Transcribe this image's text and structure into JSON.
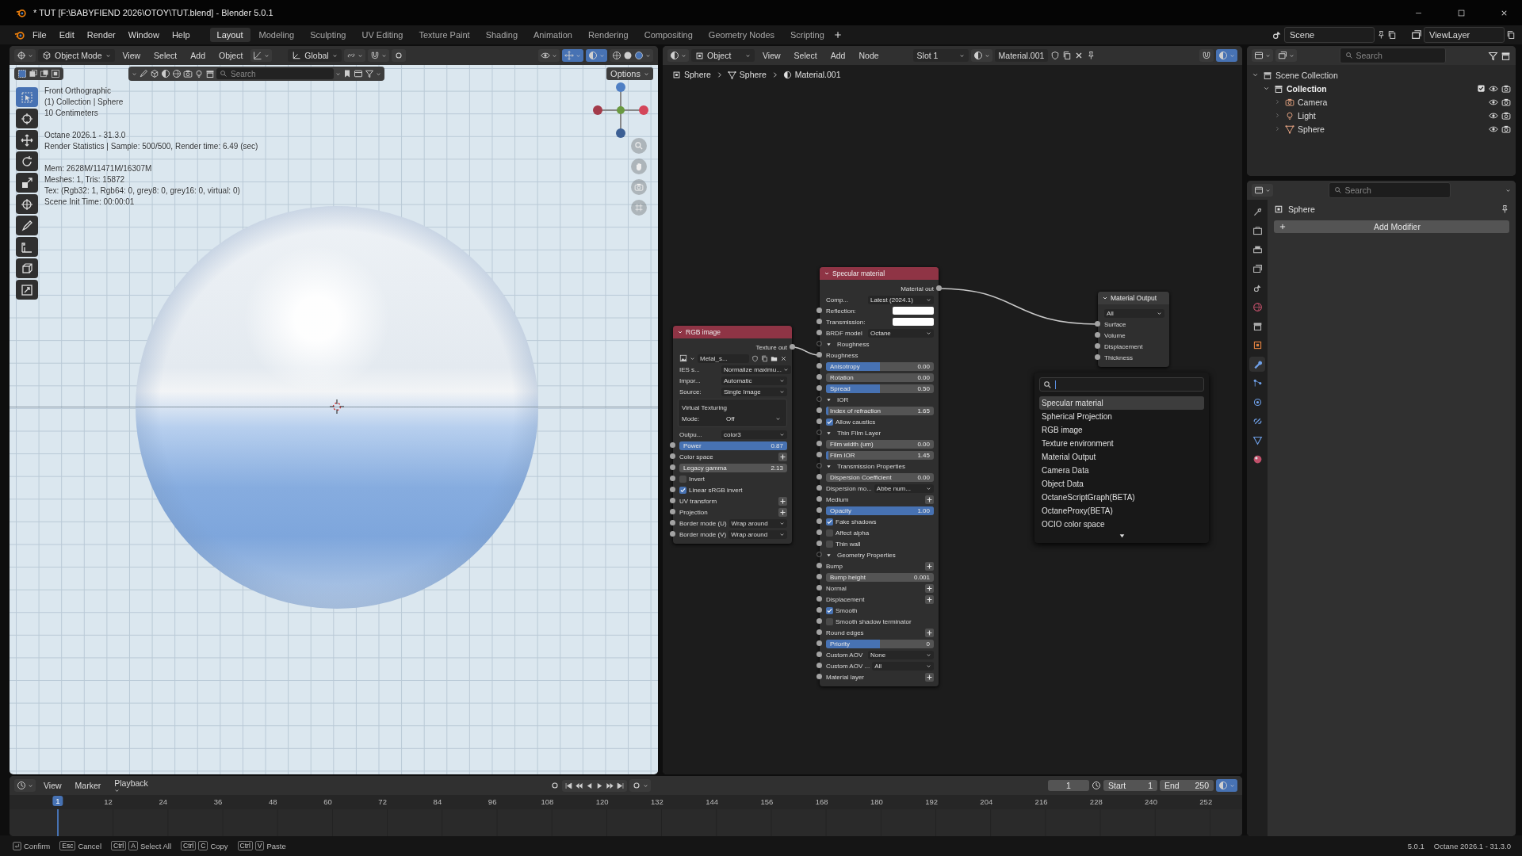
{
  "window": {
    "title": "* TUT [F:\\BABYFIEND 2026\\OTOY\\TUT.blend] - Blender 5.0.1"
  },
  "menu": [
    "File",
    "Edit",
    "Render",
    "Window",
    "Help"
  ],
  "workspaces": [
    {
      "label": "Layout",
      "selected": true
    },
    {
      "label": "Modeling",
      "selected": false
    },
    {
      "label": "Sculpting",
      "selected": false
    },
    {
      "label": "UV Editing",
      "selected": false
    },
    {
      "label": "Texture Paint",
      "selected": false
    },
    {
      "label": "Shading",
      "selected": false
    },
    {
      "label": "Animation",
      "selected": false
    },
    {
      "label": "Rendering",
      "selected": false
    },
    {
      "label": "Compositing",
      "selected": false
    },
    {
      "label": "Geometry Nodes",
      "selected": false
    },
    {
      "label": "Scripting",
      "selected": false
    }
  ],
  "scene": "Scene",
  "view_layer": "ViewLayer",
  "viewport": {
    "mode": "Object Mode",
    "menus": [
      "View",
      "Select",
      "Add",
      "Object"
    ],
    "orientation": "Global",
    "search": {
      "placeholder": "Search"
    },
    "options": "Options",
    "tools": [
      {
        "kind": "select",
        "selected": true
      },
      {
        "kind": "cursor",
        "selected": false
      },
      {
        "kind": "move",
        "selected": false
      },
      {
        "kind": "rotate",
        "selected": false
      },
      {
        "kind": "scale",
        "selected": false
      },
      {
        "kind": "transform",
        "selected": false
      },
      {
        "kind": "annotate",
        "selected": false
      },
      {
        "kind": "measure",
        "selected": false
      },
      {
        "kind": "add_cube",
        "selected": false
      },
      {
        "kind": "crop",
        "selected": false
      }
    ],
    "overlay": [
      [
        "Front Orthographic",
        "(1) Collection | Sphere",
        "10 Centimeters"
      ],
      [
        "Octane 2026.1 - 31.3.0",
        "Render Statistics | Sample: 500/500, Render time: 6.49 (sec)"
      ],
      [
        "Mem: 2628M/11471M/16307M",
        "Meshes: 1, Tris: 15872",
        "Tex: (Rgb32: 1, Rgb64: 0, grey8: 0, grey16: 0, virtual: 0)",
        "Scene Init Time: 00:00:01"
      ]
    ]
  },
  "node_editor": {
    "type": "Object",
    "menus": [
      "View",
      "Select",
      "Add",
      "Node"
    ],
    "slot": "Slot 1",
    "material": "Material.001",
    "breadcrumbs": [
      "Sphere",
      "Sphere",
      "Material.001"
    ],
    "nodes": [
      {
        "title": "RGB image",
        "kind": "texture",
        "rows": [
          {
            "kind": "output",
            "label": "Texture out",
            "socket": true
          },
          {
            "kind": "image",
            "value": "Metal_s...",
            "socket": false
          },
          {
            "kind": "dropdown",
            "label": "IES s...",
            "value": "Normalize maximu...",
            "socket": false
          },
          {
            "kind": "dropdown",
            "label": "Impor...",
            "value": "Automatic",
            "socket": false
          },
          {
            "kind": "dropdown",
            "label": "Source:",
            "value": "Single Image",
            "socket": false
          },
          {
            "kind": "group",
            "label": "Virtual Texturing",
            "socket": false,
            "rows": [
              {
                "kind": "dropdown",
                "label": "Mode:",
                "value": "Off",
                "socket": false
              }
            ]
          },
          {
            "kind": "dropdown",
            "label": "Outpu...",
            "value": "color3",
            "socket": false
          },
          {
            "kind": "slider",
            "label": "Power",
            "value": "0.87",
            "level": 1,
            "socket": true
          },
          {
            "kind": "add",
            "label": "Color space",
            "socket": true
          },
          {
            "kind": "slider",
            "label": "Legacy gamma",
            "value": "2.13",
            "level": 0,
            "socket": true
          },
          {
            "kind": "checkbox",
            "label": "Invert",
            "checked": false,
            "socket": true
          },
          {
            "kind": "checkbox",
            "label": "Linear sRGB invert",
            "checked": true,
            "socket": true
          },
          {
            "kind": "add",
            "label": "UV transform",
            "socket": true
          },
          {
            "kind": "add",
            "label": "Projection",
            "socket": true
          },
          {
            "kind": "dropdown",
            "label": "Border mode (U)",
            "value": "Wrap around",
            "socket": true
          },
          {
            "kind": "dropdown",
            "label": "Border mode (V)",
            "value": "Wrap around",
            "socket": true
          }
        ]
      },
      {
        "title": "Specular material",
        "kind": "material",
        "rows": [
          {
            "kind": "output",
            "label": "Material out",
            "socket": true
          },
          {
            "kind": "dropdown",
            "label": "Comp...",
            "value": "Latest (2024.1)",
            "socket": false
          },
          {
            "kind": "color",
            "label": "Reflection:",
            "color": "#ffffff",
            "socket": true
          },
          {
            "kind": "color",
            "label": "Transmission:",
            "color": "#ffffff",
            "socket": true
          },
          {
            "kind": "dropdown",
            "label": "BRDF model",
            "value": "Octane",
            "socket": true
          },
          {
            "kind": "section",
            "label": "Roughness",
            "expanded": true,
            "socket": true
          },
          {
            "kind": "input",
            "label": "Roughness",
            "socket": true
          },
          {
            "kind": "slider",
            "label": "Anisotropy",
            "value": "0.00",
            "level": 0.5,
            "socket": true
          },
          {
            "kind": "slider",
            "label": "Rotation",
            "value": "0.00",
            "level": 0,
            "socket": true
          },
          {
            "kind": "slider",
            "label": "Spread",
            "value": "0.50",
            "level": 0.5,
            "socket": true
          },
          {
            "kind": "section",
            "label": "IOR",
            "expanded": true,
            "socket": true
          },
          {
            "kind": "slider",
            "label": "Index of refraction",
            "value": "1.65",
            "level": 0.02,
            "socket": true
          },
          {
            "kind": "checkbox",
            "label": "Allow caustics",
            "checked": true,
            "socket": true
          },
          {
            "kind": "section",
            "label": "Thin Film Layer",
            "expanded": true,
            "socket": true
          },
          {
            "kind": "slider",
            "label": "Film width (um)",
            "value": "0.00",
            "level": 0,
            "socket": true
          },
          {
            "kind": "slider",
            "label": "Film IOR",
            "value": "1.45",
            "level": 0.02,
            "socket": true
          },
          {
            "kind": "section",
            "label": "Transmission Properties",
            "expanded": true,
            "socket": true
          },
          {
            "kind": "slider",
            "label": "Dispersion Coefficient",
            "value": "0.00",
            "level": 0,
            "socket": true
          },
          {
            "kind": "dropdown",
            "label": "Dispersion mo...",
            "value": "Abbe num...",
            "socket": true
          },
          {
            "kind": "add",
            "label": "Medium",
            "socket": true
          },
          {
            "kind": "slider",
            "label": "Opacity",
            "value": "1.00",
            "level": 1,
            "socket": true
          },
          {
            "kind": "checkbox",
            "label": "Fake shadows",
            "checked": true,
            "socket": true
          },
          {
            "kind": "checkbox",
            "label": "Affect alpha",
            "checked": false,
            "socket": true
          },
          {
            "kind": "checkbox",
            "label": "Thin wall",
            "checked": false,
            "socket": true
          },
          {
            "kind": "section",
            "label": "Geometry Properties",
            "expanded": true,
            "socket": true
          },
          {
            "kind": "add",
            "label": "Bump",
            "socket": true
          },
          {
            "kind": "slider",
            "label": "Bump height",
            "value": "0.001",
            "level": 0,
            "socket": true
          },
          {
            "kind": "add",
            "label": "Normal",
            "socket": true
          },
          {
            "kind": "add",
            "label": "Displacement",
            "socket": true
          },
          {
            "kind": "checkbox",
            "label": "Smooth",
            "checked": true,
            "socket": true
          },
          {
            "kind": "checkbox",
            "label": "Smooth shadow terminator",
            "checked": false,
            "socket": true
          },
          {
            "kind": "add",
            "label": "Round edges",
            "socket": true
          },
          {
            "kind": "slider",
            "label": "Priority",
            "value": "0",
            "level": 0.5,
            "socket": true
          },
          {
            "kind": "dropdown",
            "label": "Custom AOV",
            "value": "None",
            "socket": true
          },
          {
            "kind": "dropdown",
            "label": "Custom AOV ...",
            "value": "All",
            "socket": true
          },
          {
            "kind": "add",
            "label": "Material layer",
            "socket": true
          }
        ]
      },
      {
        "title": "Material Output",
        "kind": "output",
        "rows": [
          {
            "kind": "dropdown",
            "value": "All",
            "socket": false
          },
          {
            "kind": "input",
            "label": "Surface",
            "socket": true
          },
          {
            "kind": "input",
            "label": "Volume",
            "socket": true
          },
          {
            "kind": "input",
            "label": "Displacement",
            "socket": true
          },
          {
            "kind": "input",
            "label": "Thickness",
            "socket": true
          }
        ]
      }
    ],
    "search_menu": {
      "items": [
        {
          "label": "Specular material",
          "selected": true
        },
        {
          "label": "Spherical Projection",
          "selected": false
        },
        {
          "label": "RGB image",
          "selected": false
        },
        {
          "label": "Texture environment",
          "selected": false
        },
        {
          "label": "Material Output",
          "selected": false
        },
        {
          "label": "Camera Data",
          "selected": false
        },
        {
          "label": "Object Data",
          "selected": false
        },
        {
          "label": "OctaneScriptGraph(BETA)",
          "selected": false
        },
        {
          "label": "OctaneProxy(BETA)",
          "selected": false
        },
        {
          "label": "OCIO color space",
          "selected": false
        }
      ]
    }
  },
  "outliner": {
    "search": {
      "placeholder": "Search"
    },
    "tree": [
      {
        "label": "Scene Collection",
        "kind": "scene_collection",
        "expanded": true,
        "children": [
          {
            "label": "Collection",
            "kind": "collection",
            "expanded": true,
            "checked": true,
            "children": [
              {
                "label": "Camera",
                "kind": "camera"
              },
              {
                "label": "Light",
                "kind": "light"
              },
              {
                "label": "Sphere",
                "kind": "mesh"
              }
            ]
          }
        ]
      }
    ]
  },
  "properties": {
    "search": {
      "placeholder": "Search"
    },
    "tabs": [
      {
        "kind": "tool",
        "selected": false
      },
      {
        "kind": "render",
        "selected": false
      },
      {
        "kind": "output",
        "selected": false
      },
      {
        "kind": "view_layer",
        "selected": false
      },
      {
        "kind": "scene",
        "selected": false
      },
      {
        "kind": "world",
        "selected": false
      },
      {
        "kind": "collection",
        "selected": false
      },
      {
        "kind": "object",
        "selected": false
      },
      {
        "kind": "modifier",
        "selected": true
      },
      {
        "kind": "particles",
        "selected": false
      },
      {
        "kind": "physics",
        "selected": false
      },
      {
        "kind": "constraints",
        "selected": false
      },
      {
        "kind": "data",
        "selected": false
      },
      {
        "kind": "material",
        "selected": false
      }
    ],
    "object": "Sphere",
    "add_modifier": "Add Modifier"
  },
  "timeline": {
    "menus": [
      "View",
      "Marker",
      "Playback"
    ],
    "current_frame": "1",
    "start": {
      "label": "Start",
      "value": "1"
    },
    "end": {
      "label": "End",
      "value": "250"
    },
    "ticks": [
      {
        "label": "1",
        "selected": true
      },
      {
        "label": "12",
        "selected": false
      },
      {
        "label": "24",
        "selected": false
      },
      {
        "label": "36",
        "selected": false
      },
      {
        "label": "48",
        "selected": false
      },
      {
        "label": "60",
        "selected": false
      },
      {
        "label": "72",
        "selected": false
      },
      {
        "label": "84",
        "selected": false
      },
      {
        "label": "96",
        "selected": false
      },
      {
        "label": "108",
        "selected": false
      },
      {
        "label": "120",
        "selected": false
      },
      {
        "label": "132",
        "selected": false
      },
      {
        "label": "144",
        "selected": false
      },
      {
        "label": "156",
        "selected": false
      },
      {
        "label": "168",
        "selected": false
      },
      {
        "label": "180",
        "selected": false
      },
      {
        "label": "192",
        "selected": false
      },
      {
        "label": "204",
        "selected": false
      },
      {
        "label": "216",
        "selected": false
      },
      {
        "label": "228",
        "selected": false
      },
      {
        "label": "240",
        "selected": false
      },
      {
        "label": "252",
        "selected": false
      }
    ]
  },
  "status_bar": {
    "hints": [
      {
        "kind": "enter",
        "label": "Confirm"
      },
      {
        "kind": "keys",
        "keys": [
          "Esc"
        ],
        "label": "Cancel"
      },
      {
        "kind": "keys",
        "keys": [
          "Ctrl",
          "A"
        ],
        "label": "Select All"
      },
      {
        "kind": "keys",
        "keys": [
          "Ctrl",
          "C"
        ],
        "label": "Copy"
      },
      {
        "kind": "keys",
        "keys": [
          "Ctrl",
          "V"
        ],
        "label": "Paste"
      }
    ],
    "version": "5.0.1",
    "renderer": "Octane 2026.1 - 31.3.0"
  }
}
